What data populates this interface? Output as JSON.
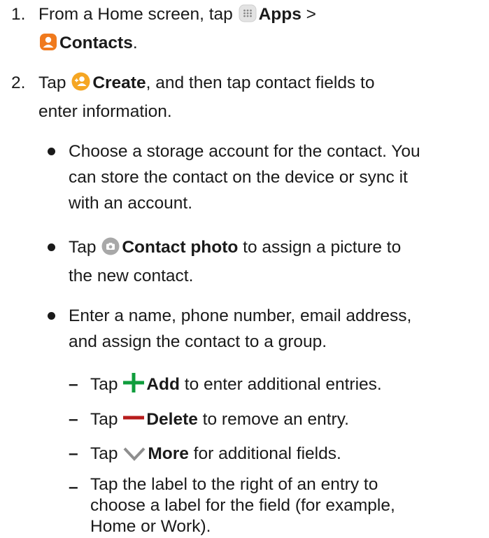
{
  "steps": [
    {
      "number": "1.",
      "t1": "From a Home screen, tap",
      "apps": "Apps",
      "sep": " >",
      "contacts": "Contacts",
      "end": "."
    },
    {
      "number": "2.",
      "t1": "Tap",
      "create": "Create",
      "line1_rest": ", and then tap contact fields to",
      "line2": "enter information."
    }
  ],
  "bullets": [
    {
      "line1": "Choose a storage account for the contact. You",
      "line2": "can store the contact on the device or sync it",
      "line3": "with an account."
    },
    {
      "pre": "Tap",
      "bold": "Contact photo",
      "post": " to assign a picture to",
      "line2": "the new contact."
    },
    {
      "line1": "Enter a name, phone number, email address,",
      "line2": "and assign the contact to a group."
    }
  ],
  "sub": [
    {
      "dash": "–",
      "pre": "Tap",
      "bold": "Add",
      "post": " to enter additional entries."
    },
    {
      "dash": "–",
      "pre": "Tap",
      "bold": "Delete",
      "post": " to remove an entry."
    },
    {
      "dash": "–",
      "pre": "Tap",
      "bold": "More",
      "post": " for additional fields."
    },
    {
      "dash": "–",
      "line1": "Tap the label to the right of an entry to",
      "line2": "choose a label for the field (for example,",
      "line3": "Home or Work)."
    }
  ],
  "colors": {
    "apps_icon": "#e3e3e3",
    "contacts_icon": "#f07a1d",
    "create_icon": "#f5a623",
    "photo_icon": "#a8a8a8",
    "add": "#0f9d3c",
    "delete": "#b71c1c",
    "more": "#8e8e8e"
  }
}
